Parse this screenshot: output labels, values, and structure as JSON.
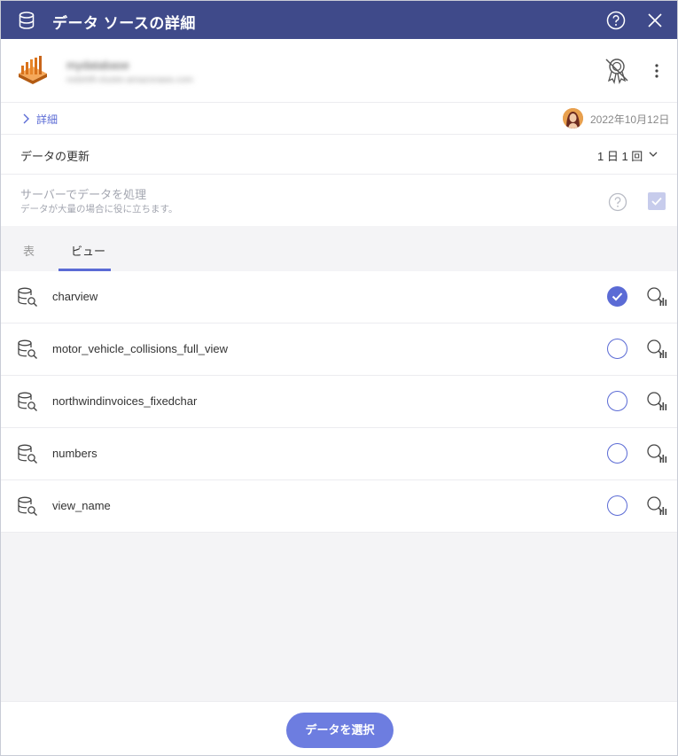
{
  "dialog": {
    "title": "データ ソースの詳細",
    "header_color": "#3f4a8a",
    "icons": {
      "datasource": "database-icon",
      "help": "help-icon",
      "close": "close-icon"
    }
  },
  "source": {
    "name": "mydatabase",
    "subtitle": "redshift-cluster.amazonaws.com",
    "certified_icon": "certified-off-icon",
    "more_icon": "more-vertical-icon"
  },
  "details": {
    "label": "詳細",
    "date": "2022年10月12日"
  },
  "refresh": {
    "label": "データの更新",
    "value": "1 日 1 回"
  },
  "server_processing": {
    "label": "サーバーでデータを処理",
    "description": "データが大量の場合に役に立ちます。",
    "checked": true
  },
  "tabs": [
    {
      "label": "表",
      "active": false
    },
    {
      "label": "ビュー",
      "active": true
    }
  ],
  "views": [
    {
      "name": "charview",
      "selected": true
    },
    {
      "name": "motor_vehicle_collisions_full_view",
      "selected": false
    },
    {
      "name": "northwindinvoices_fixedchar",
      "selected": false
    },
    {
      "name": "numbers",
      "selected": false
    },
    {
      "name": "view_name",
      "selected": false
    }
  ],
  "footer": {
    "select_button": "データを選択"
  },
  "colors": {
    "accent": "#5b6bd5",
    "button": "#6d7de0",
    "panel": "#f4f4f6"
  }
}
